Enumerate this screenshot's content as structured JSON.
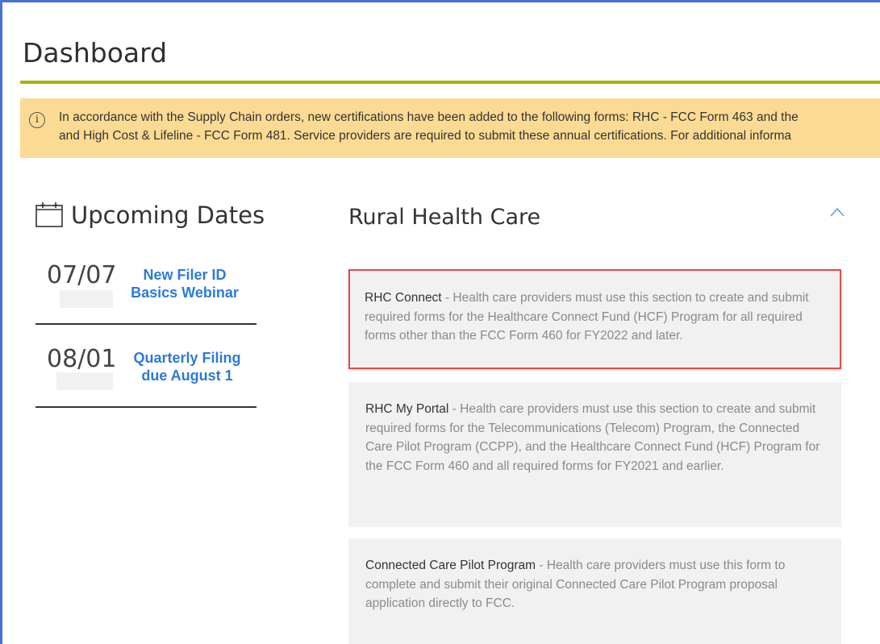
{
  "page": {
    "title": "Dashboard"
  },
  "alert": {
    "icon": "info-icon",
    "line1": "In accordance with the Supply Chain orders, new certifications have been added to the following forms: RHC - FCC Form 463 and the",
    "line2": "and High Cost & Lifeline - FCC Form 481. Service providers are required to submit these annual certifications. For additional informa"
  },
  "upcoming": {
    "title": "Upcoming Dates",
    "icon": "calendar-icon",
    "items": [
      {
        "date": "07/07",
        "line1": "New Filer ID",
        "line2": "Basics Webinar"
      },
      {
        "date": "08/01",
        "line1": "Quarterly Filing",
        "line2": "due August 1"
      }
    ]
  },
  "rhc": {
    "title": "Rural Health Care",
    "toggle_icon": "chevron-up-icon",
    "cards": [
      {
        "name": "RHC Connect",
        "desc": " - Health care providers must use this section to create and submit required forms for the Healthcare Connect Fund (HCF) Program for all required forms other than the FCC Form 460 for FY2022 and later."
      },
      {
        "name": "RHC My Portal",
        "desc": " - Health care providers must use this section to create and submit required forms for the Telecommunications (Telecom) Program, the Connected Care Pilot Program (CCPP), and the Healthcare Connect Fund (HCF) Program for the FCC Form 460 and all required forms for FY2021 and earlier."
      },
      {
        "name": "Connected Care Pilot Program",
        "desc": " - Health care providers must use this form to complete and submit their original Connected Care Pilot Program proposal application directly to FCC."
      }
    ]
  },
  "colors": {
    "accent_rule": "#a8b400",
    "alert_bg": "#fbdb93",
    "link": "#2c7ad6",
    "highlight_border": "#e14b4b"
  }
}
